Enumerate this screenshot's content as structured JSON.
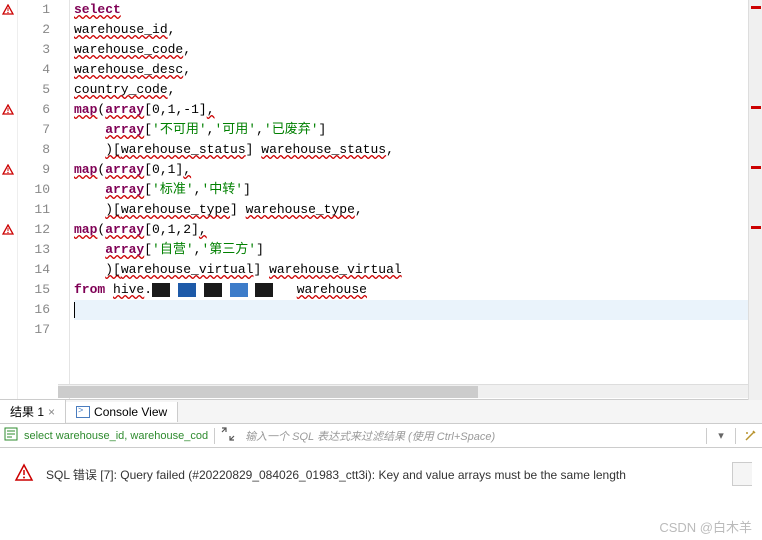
{
  "code": {
    "lines": [
      {
        "n": 1,
        "segments": [
          {
            "t": "select",
            "c": "kw squiggle"
          }
        ],
        "error": true
      },
      {
        "n": 2,
        "segments": [
          {
            "t": "warehouse_id",
            "c": "ident squiggle"
          },
          {
            "t": ",",
            "c": ""
          }
        ]
      },
      {
        "n": 3,
        "segments": [
          {
            "t": "warehouse_code",
            "c": "ident squiggle"
          },
          {
            "t": ",",
            "c": ""
          }
        ]
      },
      {
        "n": 4,
        "segments": [
          {
            "t": "warehouse_desc",
            "c": "ident squiggle"
          },
          {
            "t": ",",
            "c": ""
          }
        ]
      },
      {
        "n": 5,
        "segments": [
          {
            "t": "country_code",
            "c": "ident squiggle"
          },
          {
            "t": ",",
            "c": ""
          }
        ]
      },
      {
        "n": 6,
        "segments": [
          {
            "t": "map",
            "c": "fn squiggle"
          },
          {
            "t": "(",
            "c": ""
          },
          {
            "t": "array",
            "c": "fn squiggle"
          },
          {
            "t": "[",
            "c": ""
          },
          {
            "t": "0",
            "c": "num"
          },
          {
            "t": ",",
            "c": ""
          },
          {
            "t": "1",
            "c": "num"
          },
          {
            "t": ",",
            "c": ""
          },
          {
            "t": "-1",
            "c": "num"
          },
          {
            "t": "]",
            "c": ""
          },
          {
            "t": ",",
            "c": "squiggle"
          }
        ],
        "error": true
      },
      {
        "n": 7,
        "indent": "    ",
        "segments": [
          {
            "t": "array",
            "c": "fn squiggle"
          },
          {
            "t": "[",
            "c": ""
          },
          {
            "t": "'不可用'",
            "c": "str"
          },
          {
            "t": ",",
            "c": ""
          },
          {
            "t": "'可用'",
            "c": "str"
          },
          {
            "t": ",",
            "c": ""
          },
          {
            "t": "'已废弃'",
            "c": "str"
          },
          {
            "t": "]",
            "c": ""
          }
        ]
      },
      {
        "n": 8,
        "indent": "    ",
        "segments": [
          {
            "t": ")[",
            "c": "squiggle"
          },
          {
            "t": "warehouse_status",
            "c": "ident squiggle"
          },
          {
            "t": "] ",
            "c": ""
          },
          {
            "t": "warehouse_status",
            "c": "ident squiggle"
          },
          {
            "t": ",",
            "c": ""
          }
        ]
      },
      {
        "n": 9,
        "segments": [
          {
            "t": "map",
            "c": "fn squiggle"
          },
          {
            "t": "(",
            "c": ""
          },
          {
            "t": "array",
            "c": "fn squiggle"
          },
          {
            "t": "[",
            "c": ""
          },
          {
            "t": "0",
            "c": "num"
          },
          {
            "t": ",",
            "c": ""
          },
          {
            "t": "1",
            "c": "num"
          },
          {
            "t": "]",
            "c": ""
          },
          {
            "t": ",",
            "c": "squiggle"
          }
        ],
        "error": true
      },
      {
        "n": 10,
        "indent": "    ",
        "segments": [
          {
            "t": "array",
            "c": "fn squiggle"
          },
          {
            "t": "[",
            "c": ""
          },
          {
            "t": "'标准'",
            "c": "str"
          },
          {
            "t": ",",
            "c": ""
          },
          {
            "t": "'中转'",
            "c": "str"
          },
          {
            "t": "]",
            "c": ""
          }
        ]
      },
      {
        "n": 11,
        "indent": "    ",
        "segments": [
          {
            "t": ")[",
            "c": "squiggle"
          },
          {
            "t": "warehouse_type",
            "c": "ident squiggle"
          },
          {
            "t": "] ",
            "c": ""
          },
          {
            "t": "warehouse_type",
            "c": "ident squiggle"
          },
          {
            "t": ",",
            "c": ""
          }
        ]
      },
      {
        "n": 12,
        "segments": [
          {
            "t": "map",
            "c": "fn squiggle"
          },
          {
            "t": "(",
            "c": ""
          },
          {
            "t": "array",
            "c": "fn squiggle"
          },
          {
            "t": "[",
            "c": ""
          },
          {
            "t": "0",
            "c": "num"
          },
          {
            "t": ",",
            "c": ""
          },
          {
            "t": "1",
            "c": "num"
          },
          {
            "t": ",",
            "c": ""
          },
          {
            "t": "2",
            "c": "num"
          },
          {
            "t": "]",
            "c": ""
          },
          {
            "t": ",",
            "c": "squiggle"
          }
        ],
        "error": true
      },
      {
        "n": 13,
        "indent": "    ",
        "segments": [
          {
            "t": "array",
            "c": "fn squiggle"
          },
          {
            "t": "[",
            "c": ""
          },
          {
            "t": "'自营'",
            "c": "str"
          },
          {
            "t": ",",
            "c": ""
          },
          {
            "t": "'第三方'",
            "c": "str"
          },
          {
            "t": "]",
            "c": ""
          }
        ]
      },
      {
        "n": 14,
        "indent": "    ",
        "segments": [
          {
            "t": ")[",
            "c": "squiggle"
          },
          {
            "t": "warehouse_virtual",
            "c": "ident squiggle"
          },
          {
            "t": "] ",
            "c": ""
          },
          {
            "t": "warehouse_virtual",
            "c": "ident squiggle"
          }
        ]
      },
      {
        "n": 15,
        "segments": [
          {
            "t": "from",
            "c": "kw"
          },
          {
            "t": " ",
            "c": ""
          },
          {
            "t": "hive",
            "c": "ident squiggle"
          },
          {
            "t": ".",
            "c": ""
          },
          {
            "redact": [
              {
                "w": 18,
                "c": "dark"
              },
              {
                "w": 4,
                "c": ""
              },
              {
                "w": 18,
                "c": "blue1"
              },
              {
                "w": 4,
                "c": ""
              },
              {
                "w": 18,
                "c": "dark"
              },
              {
                "w": 4,
                "c": ""
              },
              {
                "w": 18,
                "c": "blue2"
              },
              {
                "w": 4,
                "c": ""
              },
              {
                "w": 18,
                "c": "dark"
              }
            ]
          },
          {
            "t": "   ",
            "c": ""
          },
          {
            "t": "warehouse",
            "c": "ident squiggle"
          }
        ]
      },
      {
        "n": 16,
        "segments": [],
        "current": true,
        "cursor": true
      },
      {
        "n": 17,
        "segments": []
      }
    ]
  },
  "tabs": {
    "result_label": "结果 1",
    "console_label": "Console View"
  },
  "filter": {
    "sql_preview": "select warehouse_id, warehouse_cod",
    "placeholder": "输入一个 SQL 表达式来过滤结果 (使用 Ctrl+Space)"
  },
  "error": {
    "message": "SQL 错误 [7]: Query failed (#20220829_084026_01983_ctt3i): Key and value arrays must be the same length"
  },
  "watermark": "CSDN @白木羊"
}
